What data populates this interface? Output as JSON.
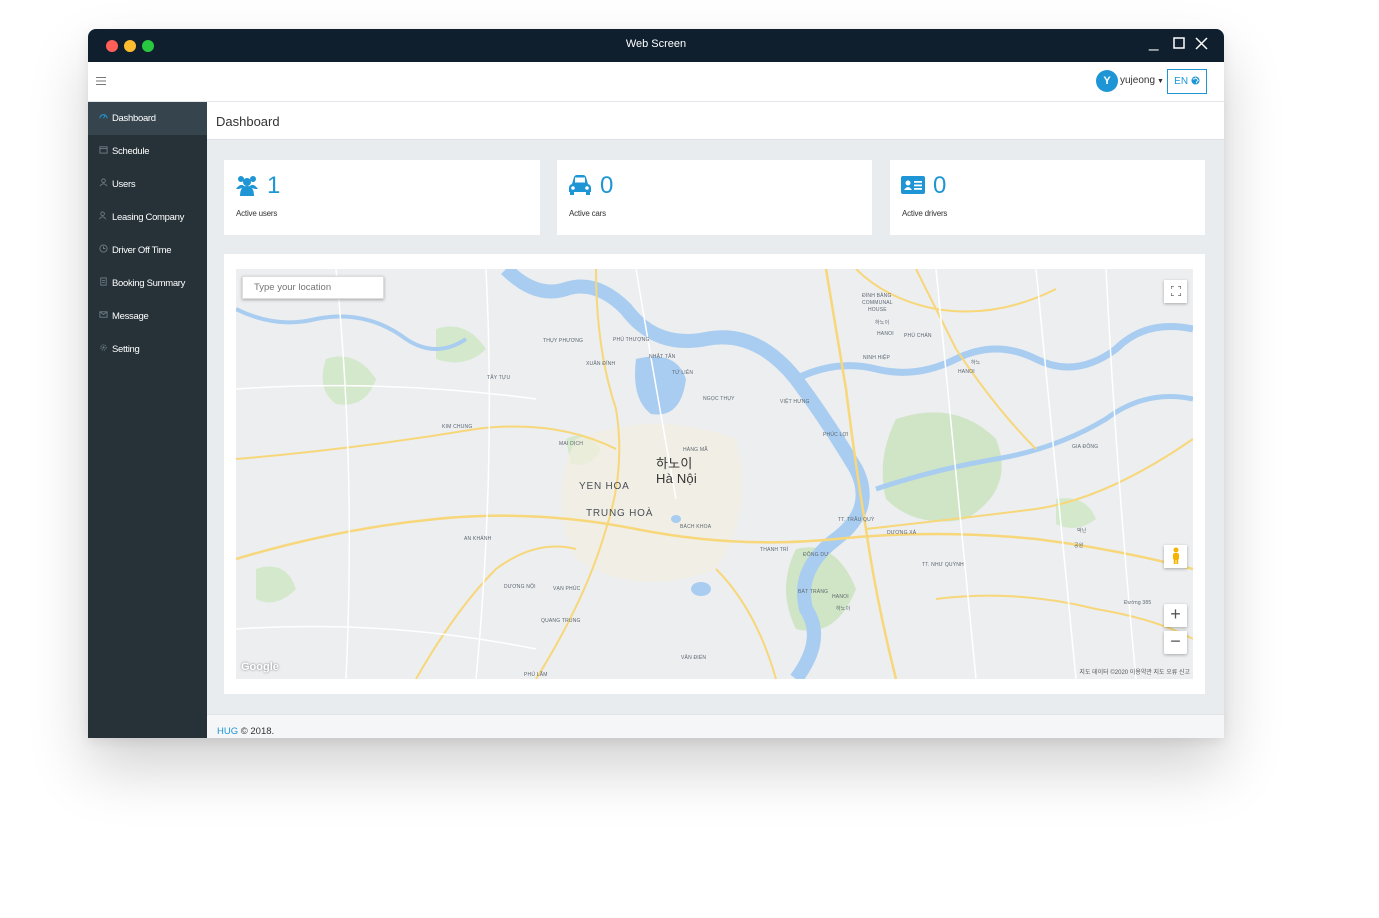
{
  "window": {
    "title": "Web Screen"
  },
  "topbar": {
    "user_initial": "Y",
    "user_name": "yujeong",
    "lang": "EN"
  },
  "sidebar": {
    "items": [
      {
        "label": "Dashboard",
        "active": true
      },
      {
        "label": "Schedule"
      },
      {
        "label": "Users"
      },
      {
        "label": "Leasing Company"
      },
      {
        "label": "Driver Off Time"
      },
      {
        "label": "Booking Summary"
      },
      {
        "label": "Message"
      },
      {
        "label": "Setting"
      }
    ]
  },
  "page": {
    "title": "Dashboard"
  },
  "stats": [
    {
      "icon": "users-icon",
      "value": "1",
      "label": "Active users"
    },
    {
      "icon": "car-icon",
      "value": "0",
      "label": "Active cars"
    },
    {
      "icon": "id-card-icon",
      "value": "0",
      "label": "Active drivers"
    }
  ],
  "map": {
    "search_placeholder": "Type your location",
    "zoom_in": "+",
    "zoom_out": "−",
    "google": "Google",
    "attribution": "지도 데이터 ©2020   이용약관   지도 오류 신고",
    "labels": {
      "dinh_bang": "ĐÌNH BẢNG",
      "communal": "COMMUNAL",
      "house": "HOUSE",
      "phu_chan": "PHÙ CHẨN",
      "ninh_hiep": "NINH HIỆP",
      "hanoi_ko_1": "하노이",
      "hanoi_1": "HANOI",
      "thuy_phuong": "THỤY PHƯƠNG",
      "phu_thuong": "PHÚ THƯỢNG",
      "nhat_tan": "NHẬT TÂN",
      "xuan_dinh": "XUÂN ĐỈNH",
      "tu_lien": "TỨ LIÊN",
      "tay_tuu": "TÂY TỰU",
      "ngoc_thuy": "NGỌC THỤY",
      "viet_hung": "VIỆT HƯNG",
      "kim_chung": "KIM CHUNG",
      "phuc_loi": "PHÚC LỢI",
      "gia_dong": "GIA ĐÔNG",
      "mai_dich": "MAI DỊCH",
      "hang_ma": "HÀNG MÃ",
      "city_ko": "하노이",
      "city_vi": "Hà Nội",
      "yen_hoa": "YEN HOA",
      "trung_hoa": "TRUNG HOÀ",
      "tt_trau_quy": "TT. TRÂU QUỲ",
      "duong_xa": "DƯƠNG XÁ",
      "bach_khoa": "BÁCH KHOA",
      "an_khanh": "AN KHÁNH",
      "thanh_tri": "THANH TRÌ",
      "dong_du": "ĐÔNG DƯ",
      "tt_nhu_quynh": "TT. NHƯ QUỲNH",
      "bac_ninh_ko": "박닌",
      "gong_won": "공원",
      "duong_noi": "DƯƠNG NỘI",
      "van_phuc": "VẠN PHÚC",
      "bat_trang": "BÁT TRÀNG",
      "hanoi_2": "HANOI",
      "hanoi_ko_2": "하노이",
      "quang_trung": "QUANG TRUNG",
      "duong_385": "Đường 385",
      "van_dien": "VĂN ĐIỂN",
      "phu_lam": "PHÚ LÃM",
      "hanoi_3": "HANOI",
      "hanoi_ko_3": "하노"
    }
  },
  "footer": {
    "brand": "HUG",
    "text": " © 2018."
  }
}
